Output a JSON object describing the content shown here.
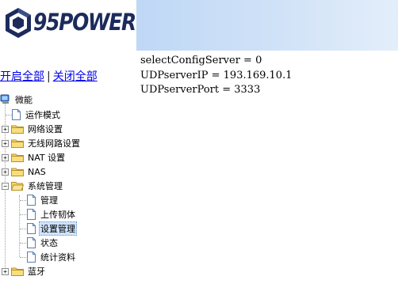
{
  "brand": {
    "logo_text": "95POWER"
  },
  "links": {
    "expand_all": "开启全部",
    "separator": "|",
    "collapse_all": "关闭全部"
  },
  "config": {
    "lines": [
      "selectConfigServer = 0",
      "UDPserverIP = 193.169.10.1",
      "UDPserverPort = 3333"
    ]
  },
  "tree": {
    "root": "微能",
    "items": [
      {
        "label": "运作模式",
        "type": "page"
      },
      {
        "label": "网络设置",
        "type": "folder",
        "expanded": false
      },
      {
        "label": "无线网路设置",
        "type": "folder",
        "expanded": false
      },
      {
        "label": "NAT 设置",
        "type": "folder",
        "expanded": false
      },
      {
        "label": "NAS",
        "type": "folder",
        "expanded": false
      },
      {
        "label": "系统管理",
        "type": "folder",
        "expanded": true
      },
      {
        "label": "管理",
        "type": "page"
      },
      {
        "label": "上传韧体",
        "type": "page"
      },
      {
        "label": "设置管理",
        "type": "page",
        "selected": true
      },
      {
        "label": "状态",
        "type": "page"
      },
      {
        "label": "统计资料",
        "type": "page"
      },
      {
        "label": "蓝牙",
        "type": "folder",
        "expanded": false
      }
    ]
  },
  "colors": {
    "header_gradient_start": "#bfd8f6",
    "header_gradient_end": "#e3eefa",
    "link": "#0000ee",
    "logo_text": "#1c2b5c"
  }
}
